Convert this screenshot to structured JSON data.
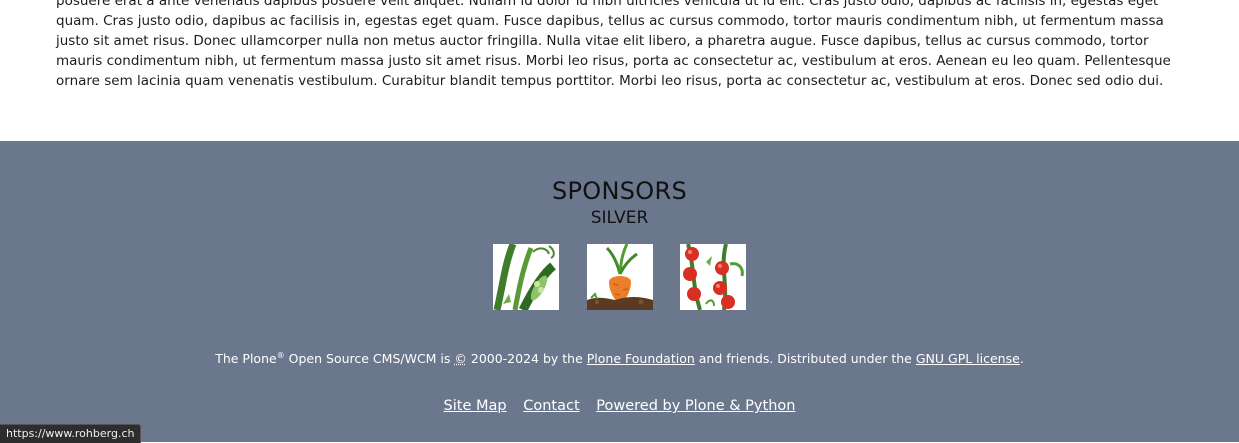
{
  "content": {
    "paragraph": "posuere erat a ante venenatis dapibus posuere velit aliquet. Nullam id dolor id nibh ultricies vehicula ut id elit. Cras justo odio, dapibus ac facilisis in, egestas eget quam. Cras justo odio, dapibus ac facilisis in, egestas eget quam. Fusce dapibus, tellus ac cursus commodo, tortor mauris condimentum nibh, ut fermentum massa justo sit amet risus. Donec ullamcorper nulla non metus auctor fringilla. Nulla vitae elit libero, a pharetra augue. Fusce dapibus, tellus ac cursus commodo, tortor mauris condimentum nibh, ut fermentum massa justo sit amet risus. Morbi leo risus, porta ac consectetur ac, vestibulum at eros. Aenean eu leo quam. Pellentesque ornare sem lacinia quam venenatis vestibulum. Curabitur blandit tempus porttitor. Morbi leo risus, porta ac consectetur ac, vestibulum at eros. Donec sed odio dui."
  },
  "footer": {
    "sponsors_title": "SPONSORS",
    "sponsors_level": "SILVER",
    "sponsors": [
      {
        "icon": "pea-pods-icon"
      },
      {
        "icon": "carrot-icon"
      },
      {
        "icon": "tomatoes-icon"
      }
    ],
    "copyright": {
      "prefix": "The Plone",
      "registered": "®",
      "middle": " Open Source CMS/WCM is ",
      "copy_symbol": "©",
      "years": " 2000-2024 by the ",
      "foundation_link": "Plone Foundation",
      "after_foundation": " and friends. Distributed under the ",
      "license_link": "GNU GPL license",
      "end": "."
    },
    "links": {
      "site_map": "Site Map",
      "contact": "Contact",
      "powered_by": "Powered by Plone & Python"
    }
  },
  "status_bar": {
    "url": "https://www.rohberg.ch"
  }
}
